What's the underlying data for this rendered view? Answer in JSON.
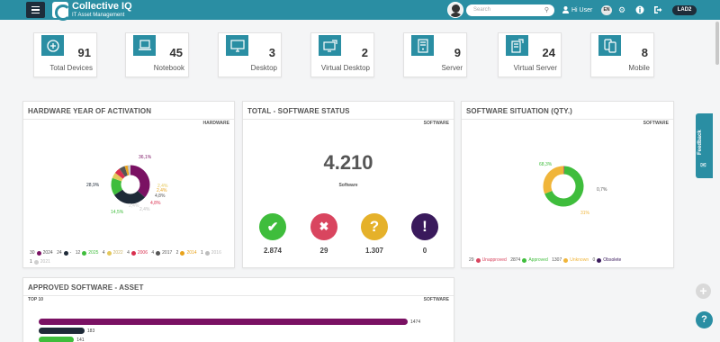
{
  "app": {
    "title": "Collective IQ",
    "subtitle": "IT Asset Management"
  },
  "header": {
    "search_placeholder": "Search",
    "user_greeting": "Hi User",
    "language": "EN",
    "tenant": "LAD2"
  },
  "devices": [
    {
      "label": "Total Devices",
      "count": "91",
      "icon": "plus-circle-icon"
    },
    {
      "label": "Notebook",
      "count": "45",
      "icon": "notebook-icon"
    },
    {
      "label": "Desktop",
      "count": "3",
      "icon": "desktop-icon"
    },
    {
      "label": "Virtual Desktop",
      "count": "2",
      "icon": "virtual-desktop-icon"
    },
    {
      "label": "Server",
      "count": "9",
      "icon": "server-icon"
    },
    {
      "label": "Virtual Server",
      "count": "24",
      "icon": "virtual-server-icon"
    },
    {
      "label": "Mobile",
      "count": "8",
      "icon": "mobile-icon"
    }
  ],
  "panels": {
    "hardware_year": {
      "title": "HARDWARE YEAR OF ACTIVATION",
      "tag": "HARDWARE",
      "slice_labels": [
        "36,1%",
        "28,9%",
        "14,5%",
        "4,8%",
        "4,8%",
        "2,4%",
        "2,4%",
        "2,4%",
        "2,4%"
      ],
      "legend": [
        {
          "count": "30",
          "label": "2024",
          "color": "#7a1163"
        },
        {
          "count": "24",
          "label": "-",
          "color": "#1e2a38"
        },
        {
          "count": "12",
          "label": "2025",
          "color": "#3fbd3c"
        },
        {
          "count": "4",
          "label": "2022",
          "color": "#e4c85c"
        },
        {
          "count": "4",
          "label": "2006",
          "color": "#d92f4e"
        },
        {
          "count": "4",
          "label": "2017",
          "color": "#555555"
        },
        {
          "count": "2",
          "label": "2014",
          "color": "#e8a21a"
        },
        {
          "count": "1",
          "label": "2016",
          "color": "#bdbdbd"
        },
        {
          "count": "1",
          "label": "2021",
          "color": "#cfcfcf"
        }
      ]
    },
    "software_status": {
      "title": "TOTAL - SOFTWARE STATUS",
      "tag": "SOFTWARE",
      "total": "4.210",
      "total_label": "Software",
      "items": [
        {
          "value": "2.874",
          "color": "#3fbd3c",
          "icon": "check-icon",
          "glyph": "✔"
        },
        {
          "value": "29",
          "color": "#d9455f",
          "icon": "cross-icon",
          "glyph": "✖"
        },
        {
          "value": "1.307",
          "color": "#e5b12a",
          "icon": "question-icon",
          "glyph": "?"
        },
        {
          "value": "0",
          "color": "#3a1a5c",
          "icon": "exclamation-icon",
          "glyph": "!"
        }
      ]
    },
    "software_situation": {
      "title": "SOFTWARE SITUATION (QTY.)",
      "tag": "SOFTWARE",
      "labels": [
        "68,3%",
        "0,7%",
        "31%"
      ],
      "legend": [
        {
          "count": "29",
          "label": "Unapproved",
          "color": "#d9455f"
        },
        {
          "count": "2874",
          "label": "Approved",
          "color": "#3fbd3c"
        },
        {
          "count": "1307",
          "label": "Unknown",
          "color": "#f0b53a"
        },
        {
          "count": "0",
          "label": "Obsolete",
          "color": "#3a1a5c"
        }
      ]
    },
    "approved_software": {
      "title": "APPROVED SOFTWARE - ASSET",
      "subtitle": "TOP 10",
      "tag": "SOFTWARE",
      "bars": [
        {
          "value": 1474,
          "label": "1474",
          "color": "#7a1163"
        },
        {
          "value": 183,
          "label": "183",
          "color": "#1e2a38"
        },
        {
          "value": 141,
          "label": "141",
          "color": "#3fbd3c"
        }
      ]
    }
  },
  "chart_data": [
    {
      "type": "pie",
      "title": "HARDWARE YEAR OF ACTIVATION",
      "categories": [
        "2024",
        "-",
        "2025",
        "2022",
        "2006",
        "2017",
        "2014",
        "2016",
        "2021"
      ],
      "values": [
        30,
        24,
        12,
        4,
        4,
        4,
        2,
        1,
        1
      ]
    },
    {
      "type": "pie",
      "title": "SOFTWARE SITUATION (QTY.)",
      "categories": [
        "Unapproved",
        "Approved",
        "Unknown",
        "Obsolete"
      ],
      "values": [
        29,
        2874,
        1307,
        0
      ]
    },
    {
      "type": "bar",
      "title": "APPROVED SOFTWARE - ASSET",
      "values": [
        1474,
        183,
        141
      ]
    }
  ],
  "floating": {
    "feedback_label": "Feedback",
    "plus_label": "+",
    "help_label": "?"
  }
}
